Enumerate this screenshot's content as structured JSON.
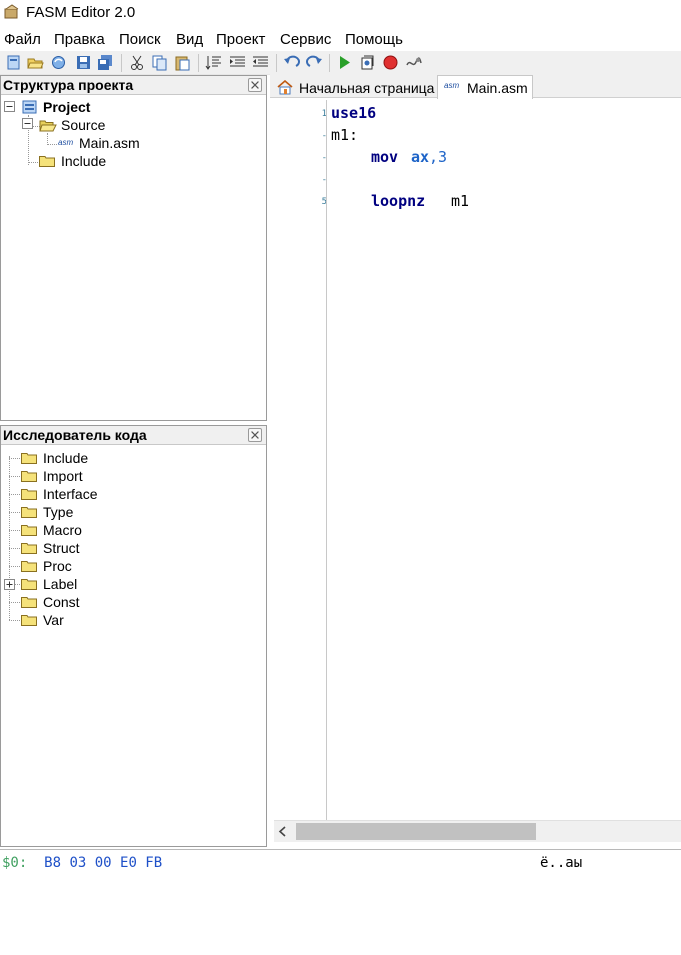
{
  "window": {
    "title": "FASM Editor 2.0"
  },
  "menu": [
    "Файл",
    "Правка",
    "Поиск",
    "Вид",
    "Проект",
    "Сервис",
    "Помощь"
  ],
  "project_panel": {
    "title": "Структура проекта",
    "root": "Project",
    "source": "Source",
    "file": "Main.asm",
    "file_badge": "asm",
    "include": "Include"
  },
  "explorer_panel": {
    "title": "Исследователь кода",
    "items": [
      "Include",
      "Import",
      "Interface",
      "Type",
      "Macro",
      "Struct",
      "Proc",
      "Label",
      "Const",
      "Var"
    ]
  },
  "tabs": {
    "home": "Начальная страница",
    "file": "Main.asm",
    "file_badge": "asm"
  },
  "editor": {
    "line_numbers": [
      "1",
      "-",
      "-",
      "-",
      "5"
    ],
    "lines": {
      "l1": "use16",
      "l2": "m1:",
      "l3_kw": "mov",
      "l3_reg": "ax",
      "l3_rest": ",3",
      "l5_kw": "loopnz",
      "l5_arg": "m1"
    }
  },
  "status": {
    "hex_label": "$0:",
    "hex_bytes": "B8 03 00 E0 FB",
    "ascii": "ё..аы"
  },
  "colors": {
    "keyword": "#000080",
    "register": "#1e64c8",
    "hex": "#1e50c8",
    "folder": "#f5e27a"
  }
}
